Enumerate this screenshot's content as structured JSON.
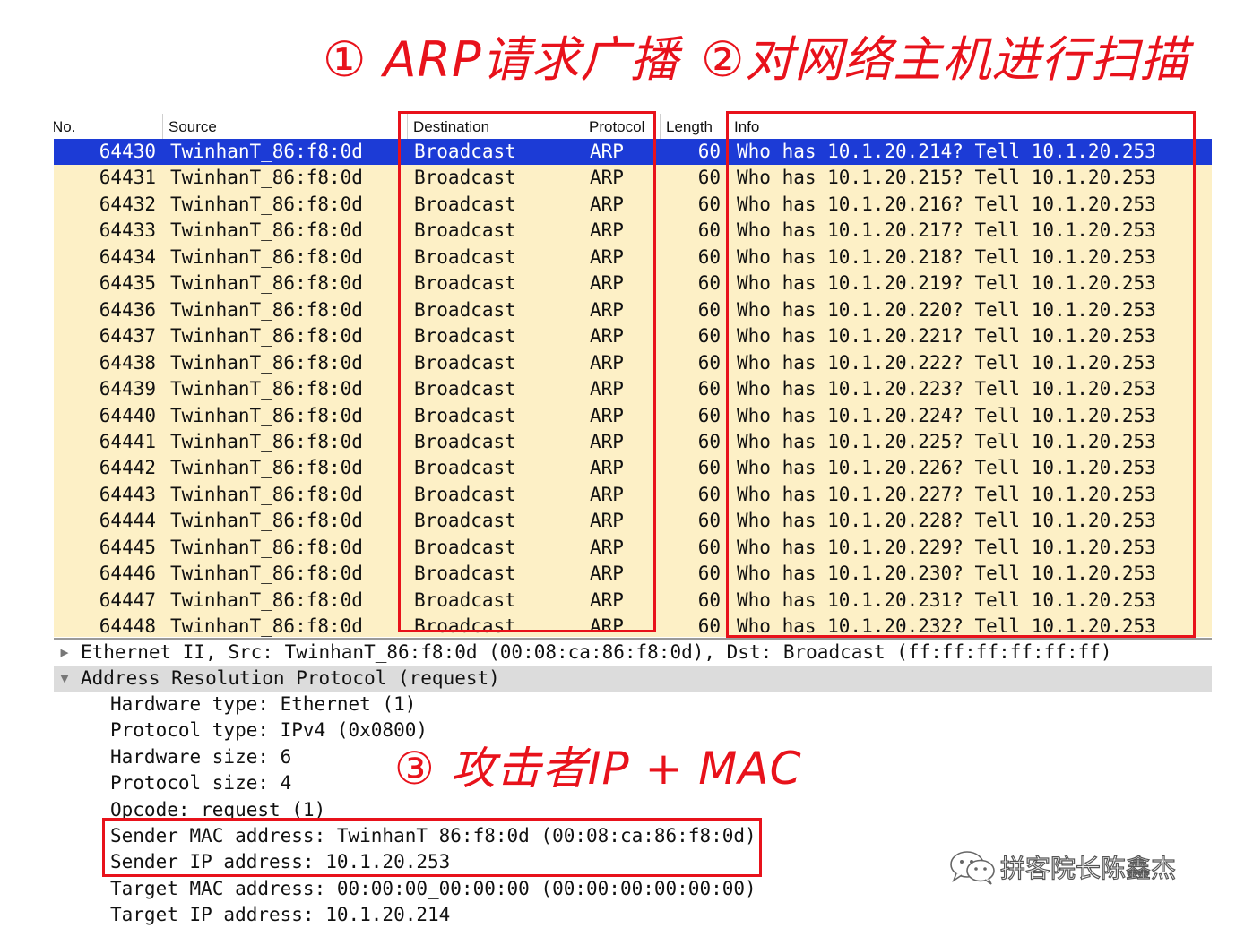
{
  "annotations": {
    "anno1": "① ARP请求广播",
    "anno2": "②对网络主机进行扫描",
    "anno3": "③ 攻击者IP + MAC"
  },
  "columns": {
    "no": "No.",
    "source": "Source",
    "destination": "Destination",
    "protocol": "Protocol",
    "length": "Length",
    "info": "Info"
  },
  "packets": [
    {
      "no": "64430",
      "source": "TwinhanT_86:f8:0d",
      "destination": "Broadcast",
      "protocol": "ARP",
      "length": "60",
      "info": "Who has 10.1.20.214? Tell 10.1.20.253"
    },
    {
      "no": "64431",
      "source": "TwinhanT_86:f8:0d",
      "destination": "Broadcast",
      "protocol": "ARP",
      "length": "60",
      "info": "Who has 10.1.20.215? Tell 10.1.20.253"
    },
    {
      "no": "64432",
      "source": "TwinhanT_86:f8:0d",
      "destination": "Broadcast",
      "protocol": "ARP",
      "length": "60",
      "info": "Who has 10.1.20.216? Tell 10.1.20.253"
    },
    {
      "no": "64433",
      "source": "TwinhanT_86:f8:0d",
      "destination": "Broadcast",
      "protocol": "ARP",
      "length": "60",
      "info": "Who has 10.1.20.217? Tell 10.1.20.253"
    },
    {
      "no": "64434",
      "source": "TwinhanT_86:f8:0d",
      "destination": "Broadcast",
      "protocol": "ARP",
      "length": "60",
      "info": "Who has 10.1.20.218? Tell 10.1.20.253"
    },
    {
      "no": "64435",
      "source": "TwinhanT_86:f8:0d",
      "destination": "Broadcast",
      "protocol": "ARP",
      "length": "60",
      "info": "Who has 10.1.20.219? Tell 10.1.20.253"
    },
    {
      "no": "64436",
      "source": "TwinhanT_86:f8:0d",
      "destination": "Broadcast",
      "protocol": "ARP",
      "length": "60",
      "info": "Who has 10.1.20.220? Tell 10.1.20.253"
    },
    {
      "no": "64437",
      "source": "TwinhanT_86:f8:0d",
      "destination": "Broadcast",
      "protocol": "ARP",
      "length": "60",
      "info": "Who has 10.1.20.221? Tell 10.1.20.253"
    },
    {
      "no": "64438",
      "source": "TwinhanT_86:f8:0d",
      "destination": "Broadcast",
      "protocol": "ARP",
      "length": "60",
      "info": "Who has 10.1.20.222? Tell 10.1.20.253"
    },
    {
      "no": "64439",
      "source": "TwinhanT_86:f8:0d",
      "destination": "Broadcast",
      "protocol": "ARP",
      "length": "60",
      "info": "Who has 10.1.20.223? Tell 10.1.20.253"
    },
    {
      "no": "64440",
      "source": "TwinhanT_86:f8:0d",
      "destination": "Broadcast",
      "protocol": "ARP",
      "length": "60",
      "info": "Who has 10.1.20.224? Tell 10.1.20.253"
    },
    {
      "no": "64441",
      "source": "TwinhanT_86:f8:0d",
      "destination": "Broadcast",
      "protocol": "ARP",
      "length": "60",
      "info": "Who has 10.1.20.225? Tell 10.1.20.253"
    },
    {
      "no": "64442",
      "source": "TwinhanT_86:f8:0d",
      "destination": "Broadcast",
      "protocol": "ARP",
      "length": "60",
      "info": "Who has 10.1.20.226? Tell 10.1.20.253"
    },
    {
      "no": "64443",
      "source": "TwinhanT_86:f8:0d",
      "destination": "Broadcast",
      "protocol": "ARP",
      "length": "60",
      "info": "Who has 10.1.20.227? Tell 10.1.20.253"
    },
    {
      "no": "64444",
      "source": "TwinhanT_86:f8:0d",
      "destination": "Broadcast",
      "protocol": "ARP",
      "length": "60",
      "info": "Who has 10.1.20.228? Tell 10.1.20.253"
    },
    {
      "no": "64445",
      "source": "TwinhanT_86:f8:0d",
      "destination": "Broadcast",
      "protocol": "ARP",
      "length": "60",
      "info": "Who has 10.1.20.229? Tell 10.1.20.253"
    },
    {
      "no": "64446",
      "source": "TwinhanT_86:f8:0d",
      "destination": "Broadcast",
      "protocol": "ARP",
      "length": "60",
      "info": "Who has 10.1.20.230? Tell 10.1.20.253"
    },
    {
      "no": "64447",
      "source": "TwinhanT_86:f8:0d",
      "destination": "Broadcast",
      "protocol": "ARP",
      "length": "60",
      "info": "Who has 10.1.20.231? Tell 10.1.20.253"
    },
    {
      "no": "64448",
      "source": "TwinhanT_86:f8:0d",
      "destination": "Broadcast",
      "protocol": "ARP",
      "length": "60",
      "info": "Who has 10.1.20.232? Tell 10.1.20.253"
    }
  ],
  "details": {
    "ethernet": "Ethernet II, Src: TwinhanT_86:f8:0d (00:08:ca:86:f8:0d), Dst: Broadcast (ff:ff:ff:ff:ff:ff)",
    "arp": "Address Resolution Protocol (request)",
    "fields": [
      "Hardware type: Ethernet (1)",
      "Protocol type: IPv4 (0x0800)",
      "Hardware size: 6",
      "Protocol size: 4",
      "Opcode: request (1)",
      "Sender MAC address: TwinhanT_86:f8:0d (00:08:ca:86:f8:0d)",
      "Sender IP address: 10.1.20.253",
      "Target MAC address: 00:00:00_00:00:00 (00:00:00:00:00:00)",
      "Target IP address: 10.1.20.214"
    ]
  },
  "watermark": "拼客院长陈鑫杰",
  "colors": {
    "selected_row": "#1c3bd6",
    "row_background": "#fdf0c6",
    "annotation_red": "#e8121b",
    "detail_shade": "#dcdcdc"
  }
}
